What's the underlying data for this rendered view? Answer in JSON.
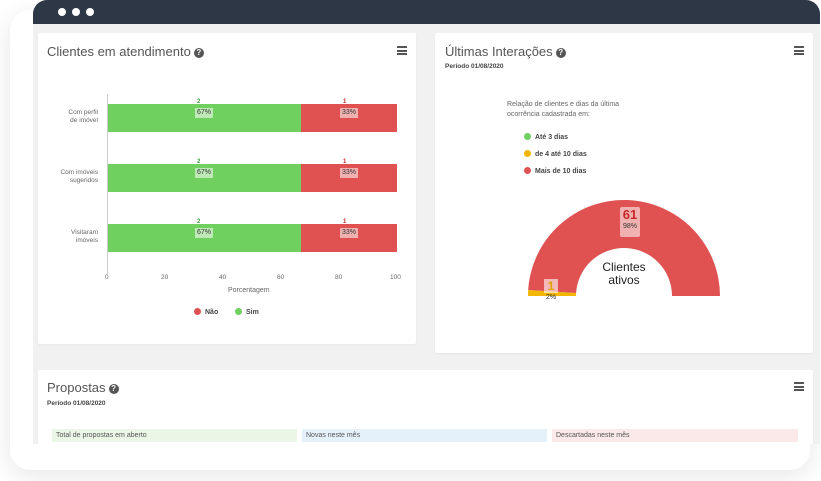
{
  "window": {
    "titlebar_color": "#2d3746"
  },
  "clientes": {
    "title": "Clientes em atendimento",
    "chart_data": {
      "type": "bar",
      "orientation": "horizontal-stacked-percent",
      "categories": [
        [
          "Com perfil",
          "de imóvel"
        ],
        [
          "Com imóveis",
          "sugeridos"
        ],
        [
          "Visitaram",
          "imóveis"
        ]
      ],
      "series": [
        {
          "name": "Sim",
          "color": "#6fcf5f",
          "counts": [
            "2",
            "2",
            "2"
          ],
          "values": [
            "67%",
            "67%",
            "67%"
          ]
        },
        {
          "name": "Não",
          "color": "#e05252",
          "counts": [
            "1",
            "1",
            "1"
          ],
          "values": [
            "33%",
            "33%",
            "33%"
          ]
        }
      ],
      "xticks": [
        "0",
        "20",
        "40",
        "60",
        "80",
        "100"
      ],
      "xlabel": "Porcentagem",
      "xlim": [
        0,
        100
      ],
      "legend": [
        {
          "label": "Não",
          "color": "#e05252"
        },
        {
          "label": "Sim",
          "color": "#6fcf5f"
        }
      ]
    }
  },
  "interacoes": {
    "title": "Últimas Interações",
    "period": "Período 01/08/2020",
    "description": [
      "Relação de clientes e dias da última",
      "ocorrência cadastrada em:"
    ],
    "legend": [
      {
        "label": "Até 3 dias",
        "color": "#6fcf5f"
      },
      {
        "label": "de 4 até 10 dias",
        "color": "#f2b705"
      },
      {
        "label": "Mais de 10 dias",
        "color": "#e05252"
      }
    ],
    "center_label": [
      "Clientes",
      "ativos"
    ],
    "chart_data": {
      "type": "pie",
      "style": "semi-donut",
      "slices": [
        {
          "name": "de 4 até 10 dias",
          "count": "1",
          "percent": "2%",
          "value": 2,
          "color": "#f2b705"
        },
        {
          "name": "Mais de 10 dias",
          "count": "61",
          "percent": "98%",
          "value": 98,
          "color": "#e05252"
        }
      ]
    }
  },
  "propostas": {
    "title": "Propostas",
    "period": "Período 01/08/2020",
    "kpis": [
      {
        "label": "Total de propostas em aberto",
        "bg": "#eaf7e6"
      },
      {
        "label": "Novas neste mês",
        "bg": "#e4f1fb"
      },
      {
        "label": "Descartadas neste mês",
        "bg": "#fbe8e8"
      }
    ]
  }
}
